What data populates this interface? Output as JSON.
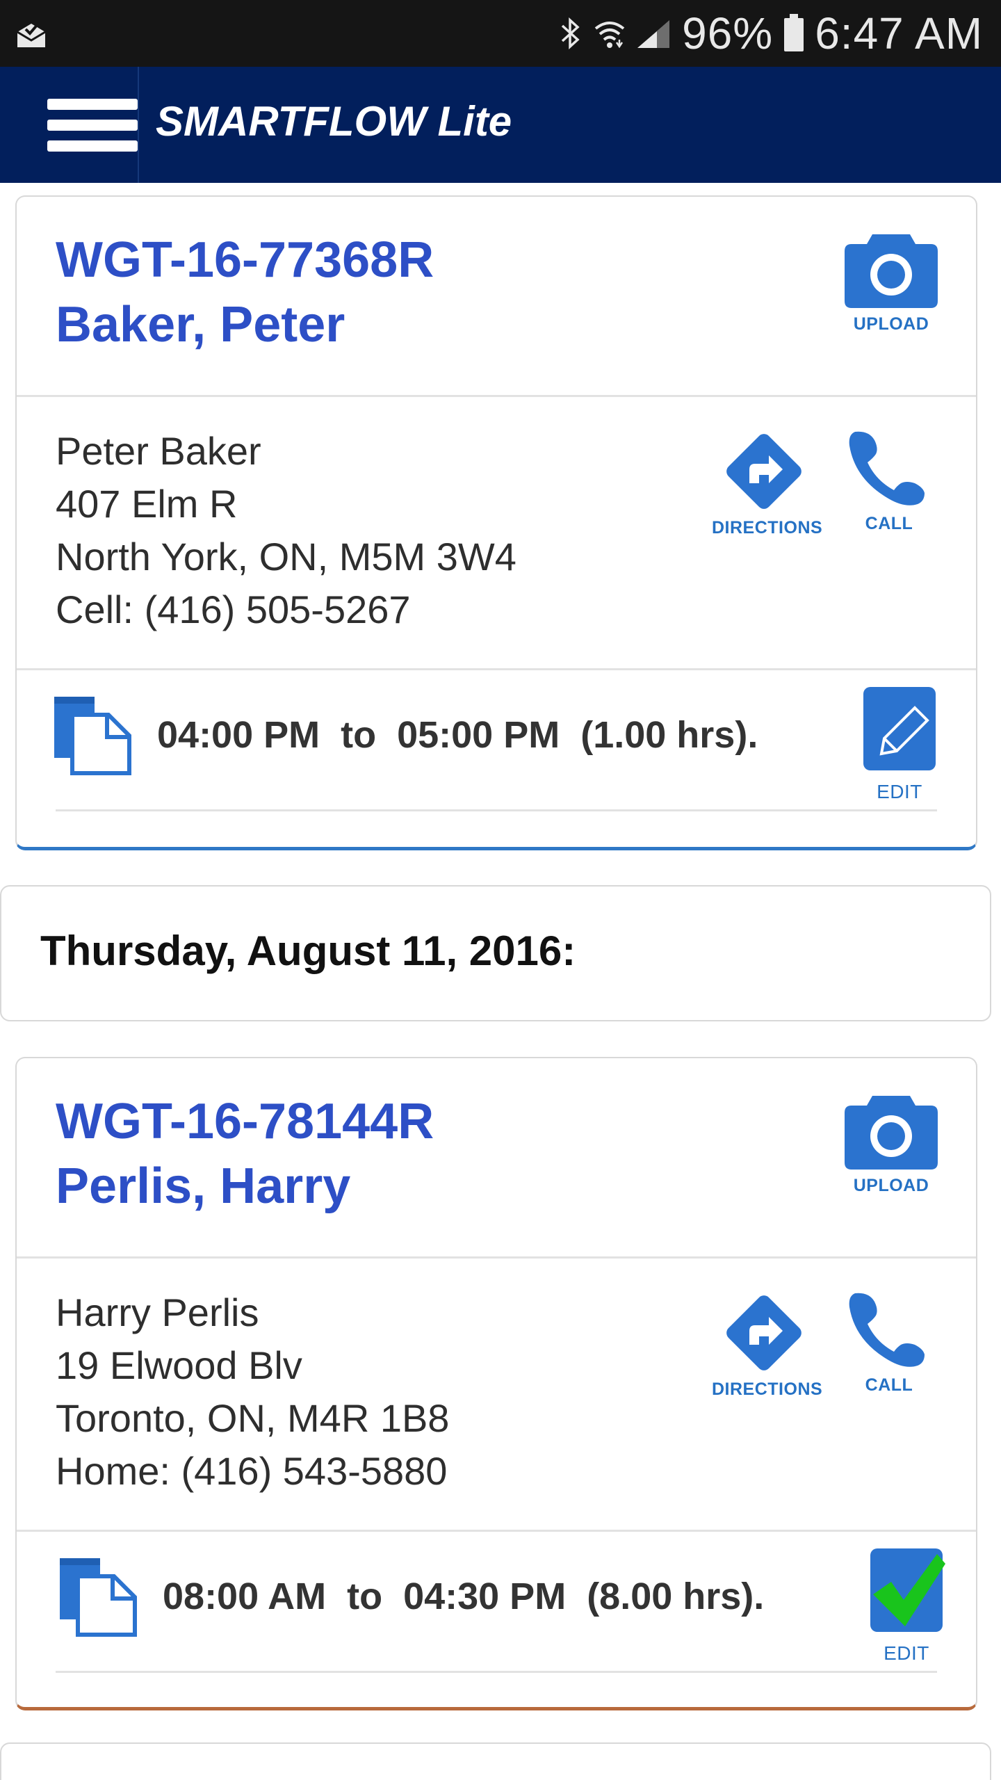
{
  "status_bar": {
    "battery": "96%",
    "time": "6:47 AM",
    "icons": [
      "mail-check-icon",
      "bluetooth-icon",
      "wifi-icon",
      "signal-icon",
      "battery-icon"
    ]
  },
  "app_bar": {
    "title": "SMARTFLOW Lite",
    "menu_icon": "hamburger-menu-icon",
    "background_color": "#021f5c"
  },
  "labels": {
    "upload": "UPLOAD",
    "directions": "DIRECTIONS",
    "call": "CALL",
    "edit": "EDIT"
  },
  "jobs": [
    {
      "id": "WGT-16-77368R",
      "name": "Baker, Peter",
      "contact": "Peter Baker",
      "street": "407 Elm R",
      "city": "North York, ON, M5M 3W4",
      "phone": "Cell: (416) 505-5267",
      "time": "04:00 PM  to  05:00 PM  (1.00 hrs).",
      "edit_state": "edit-pencil-icon"
    },
    {
      "id": "WGT-16-78144R",
      "name": "Perlis, Harry",
      "contact": "Harry Perlis",
      "street": "19 Elwood Blv",
      "city": "Toronto, ON, M4R 1B8",
      "phone": "Home: (416) 543-5880",
      "time": "08:00 AM  to  04:30 PM  (8.00 hrs).",
      "edit_state": "edit-checked-icon"
    }
  ],
  "date_header": "Thursday, August 11, 2016:",
  "colors": {
    "accent_blue": "#2d4fc6",
    "icon_blue": "#2571c4",
    "check_green": "#19c41c"
  }
}
